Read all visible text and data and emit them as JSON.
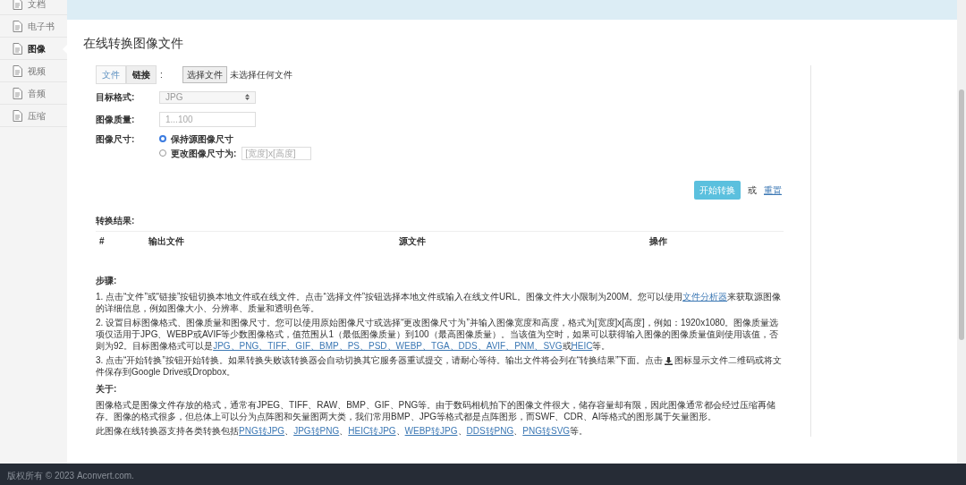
{
  "sidebar": {
    "items": [
      {
        "label": "文档",
        "selected": false
      },
      {
        "label": "电子书",
        "selected": false
      },
      {
        "label": "图像",
        "selected": true
      },
      {
        "label": "视频",
        "selected": false
      },
      {
        "label": "音频",
        "selected": false
      },
      {
        "label": "压缩",
        "selected": false
      }
    ]
  },
  "page_title": "在线转换图像文件",
  "source_tabs": [
    {
      "label": "文件",
      "selected": false
    },
    {
      "label": "链接",
      "selected": true
    }
  ],
  "source_colon": ":",
  "file_input": {
    "button": "选择文件",
    "status": "未选择任何文件"
  },
  "fields": [
    {
      "kind": "select",
      "label": "目标格式:",
      "value": "JPG"
    },
    {
      "kind": "text",
      "label": "图像质量:",
      "placeholder": "1...100"
    },
    {
      "kind": "radios",
      "label": "图像尺寸:",
      "options": [
        {
          "label": "保持源图像尺寸",
          "selected": true
        },
        {
          "label": "更改图像尺寸为:",
          "selected": false,
          "placeholder": "[宽度]x[高度]"
        }
      ]
    }
  ],
  "actions": {
    "primary": "开始转换",
    "separator": "或",
    "link": "重置"
  },
  "results": {
    "title": "转换结果:",
    "columns": [
      "#",
      "输出文件",
      "源文件",
      "操作"
    ]
  },
  "steps": {
    "title": "步骤:",
    "paragraphs": [
      [
        {
          "kind": "text",
          "text": "1. 点击“文件”或“链接”按钮切换本地文件或在线文件。点击“选择文件”按钮选择本地文件或输入在线文件URL。图像文件大小限制为200M。您可以使用"
        },
        {
          "kind": "link",
          "text": "文件分析器"
        },
        {
          "kind": "text",
          "text": "来获取源图像的详细信息，例如图像大小、分辨率、质量和透明色等。"
        }
      ],
      [
        {
          "kind": "text",
          "text": "2. 设置目标图像格式、图像质量和图像尺寸。您可以使用原始图像尺寸或选择“更改图像尺寸为”并输入图像宽度和高度，格式为[宽度]x[高度]，例如：1920x1080。图像质量选项仅适用于JPG、WEBP或AVIF等少数图像格式，值范围从1（最低图像质量）到100（最高图像质量）。当该值为空时，如果可以获得输入图像的图像质量值则使用该值，否则为92。目标图像格式可以是"
        },
        {
          "kind": "link",
          "text": "JPG、PNG、TIFF、GIF、BMP、PS、PSD、WEBP、TGA、DDS、AVIF、PNM、SVG"
        },
        {
          "kind": "text",
          "text": "或"
        },
        {
          "kind": "link",
          "text": "HEIC"
        },
        {
          "kind": "text",
          "text": "等。"
        }
      ],
      [
        {
          "kind": "text",
          "text": "3. 点击“开始转换”按钮开始转换。如果转换失败该转换器会自动切换其它服务器重试提交，请耐心等待。输出文件将会列在“转换结果”下面。点击"
        },
        {
          "kind": "icon"
        },
        {
          "kind": "text",
          "text": "图标显示文件二维码或将文件保存到Google Drive或Dropbox。"
        }
      ]
    ]
  },
  "about": {
    "title": "关于:",
    "paragraphs": [
      [
        {
          "kind": "text",
          "text": "图像格式是图像文件存放的格式，通常有JPEG、TIFF、RAW、BMP、GIF、PNG等。由于数码相机拍下的图像文件很大，储存容量却有限，因此图像通常都会经过压缩再储存。图像的格式很多，但总体上可以分为点阵图和矢量图两大类，我们常用BMP、JPG等格式都是点阵图形，而SWF、CDR、AI等格式的图形属于矢量图形。"
        }
      ],
      [
        {
          "kind": "text",
          "text": "此图像在线转换器支持各类转换包括"
        },
        {
          "kind": "link",
          "text": "PNG转JPG"
        },
        {
          "kind": "text",
          "text": "、"
        },
        {
          "kind": "link",
          "text": "JPG转PNG"
        },
        {
          "kind": "text",
          "text": "、"
        },
        {
          "kind": "link",
          "text": "HEIC转JPG"
        },
        {
          "kind": "text",
          "text": "、"
        },
        {
          "kind": "link",
          "text": "WEBP转JPG"
        },
        {
          "kind": "text",
          "text": "、"
        },
        {
          "kind": "link",
          "text": "DDS转PNG"
        },
        {
          "kind": "text",
          "text": "、"
        },
        {
          "kind": "link",
          "text": "PNG转SVG"
        },
        {
          "kind": "text",
          "text": "等。"
        }
      ]
    ]
  },
  "footer": {
    "copyright": "版权所有 © 2023 Aconvert.com."
  }
}
